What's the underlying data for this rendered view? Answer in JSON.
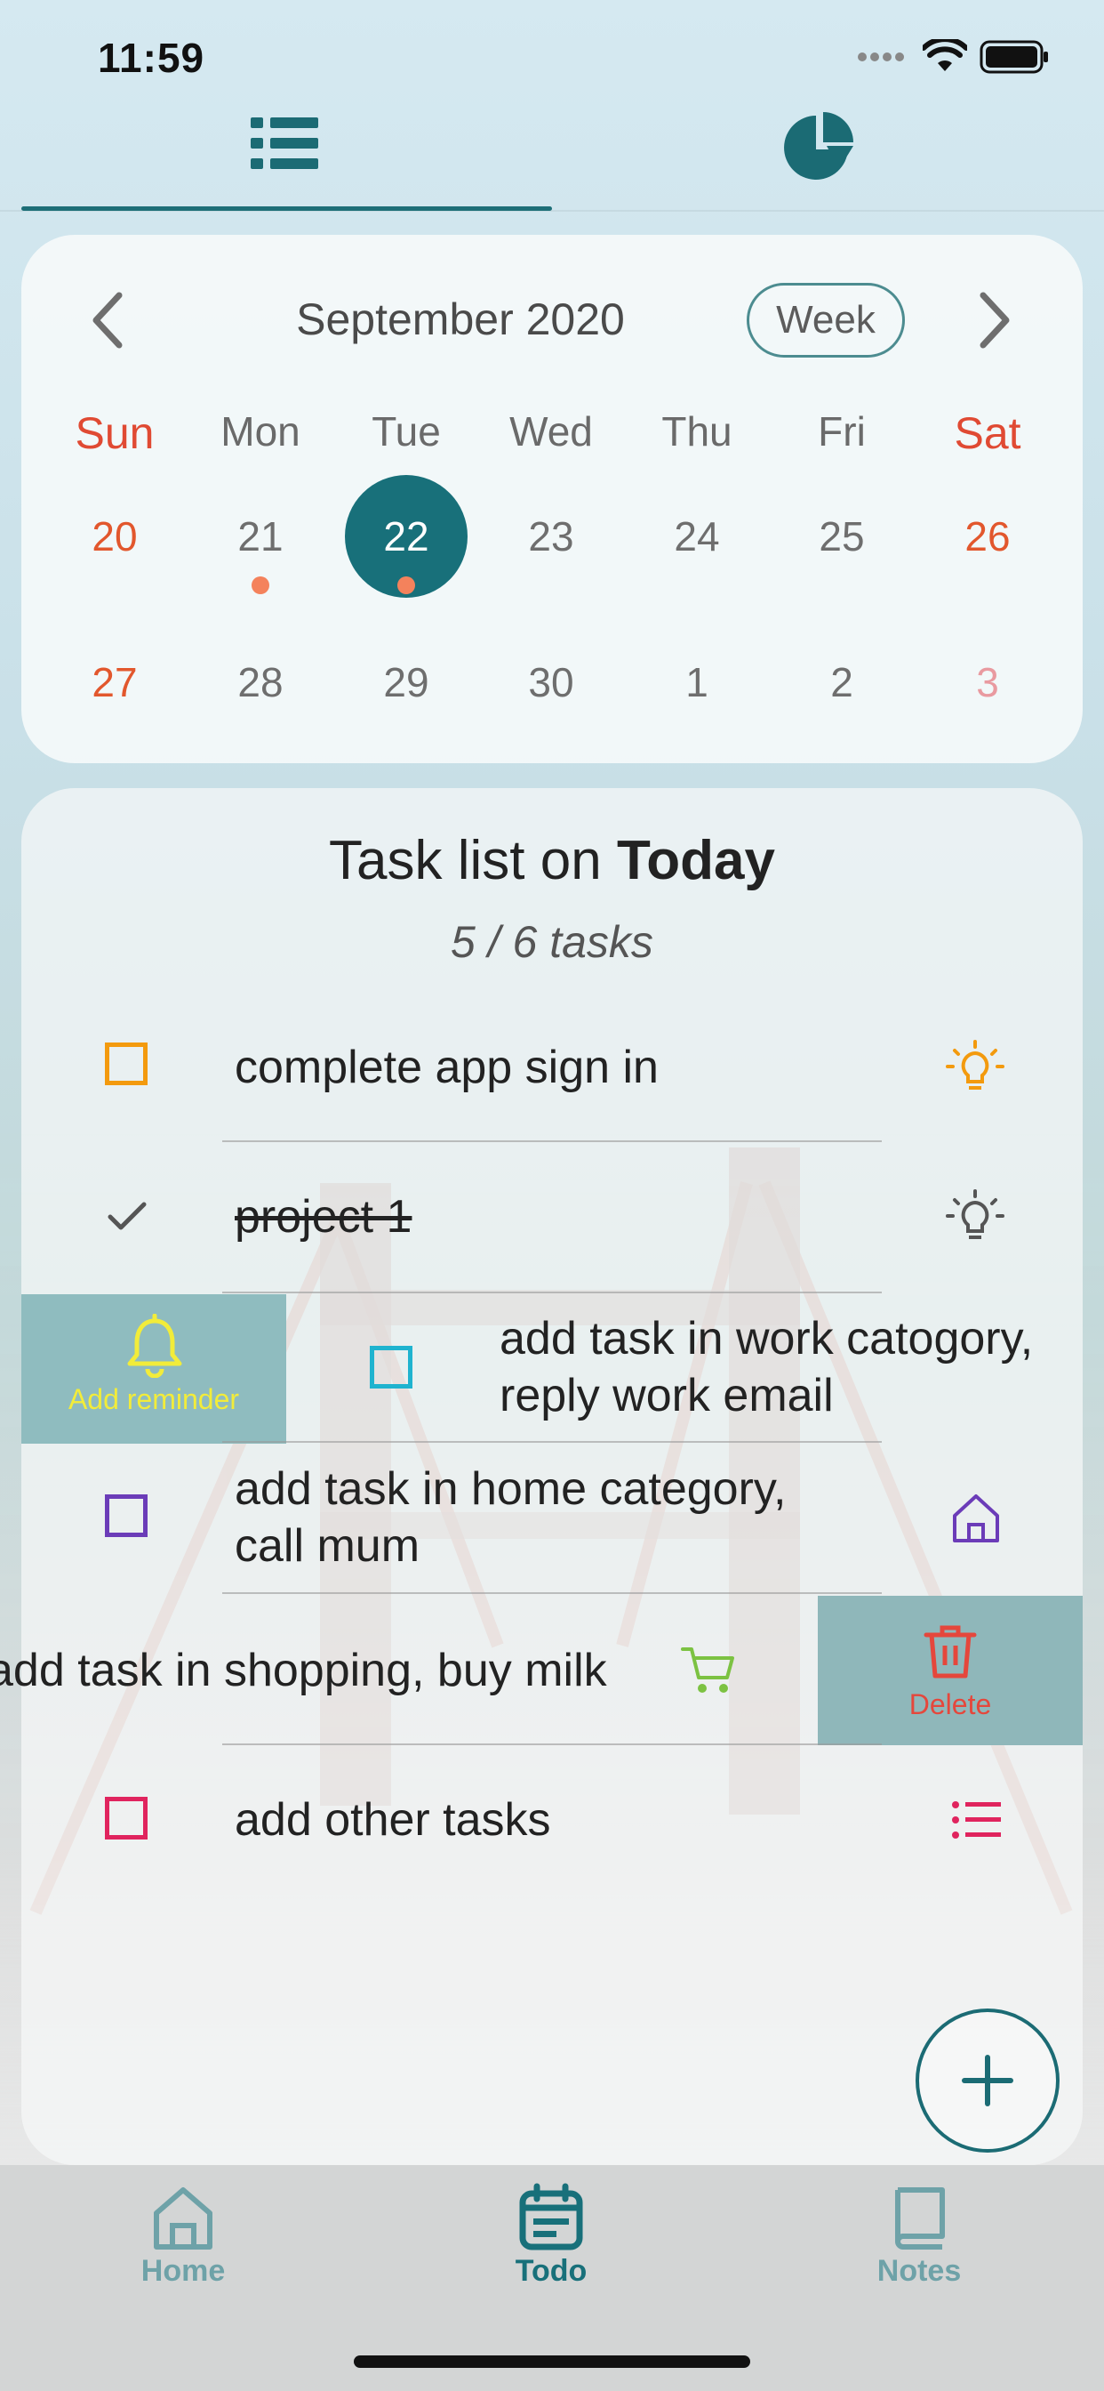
{
  "status_bar": {
    "time": "11:59"
  },
  "top_tabs": [
    {
      "name": "list",
      "icon": "list-icon",
      "active": true
    },
    {
      "name": "stats",
      "icon": "pie-chart-icon",
      "active": false
    }
  ],
  "calendar": {
    "month_label": "September 2020",
    "view_toggle": "Week",
    "weekdays": [
      "Sun",
      "Mon",
      "Tue",
      "Wed",
      "Thu",
      "Fri",
      "Sat"
    ],
    "week1": [
      "20",
      "21",
      "22",
      "23",
      "24",
      "25",
      "26"
    ],
    "week2": [
      "27",
      "28",
      "29",
      "30",
      "1",
      "2",
      "3"
    ],
    "selected": "22"
  },
  "tasks_header": {
    "prefix": "Task list on ",
    "day": "Today",
    "count": "5 / 6 tasks"
  },
  "tasks": [
    {
      "text": "complete app sign in",
      "color": "#f39a0e",
      "icon": "lightbulb-icon",
      "done": false
    },
    {
      "text": "project 1",
      "color": "#555555",
      "icon": "lightbulb-icon",
      "done": true
    },
    {
      "text": "add task in work catogory,\nreply work email",
      "color": "#1fb3cf",
      "icon": "briefcase-icon",
      "done": false
    },
    {
      "text": "add task in home category,\ncall mum",
      "color": "#6b3cb8",
      "icon": "home-icon",
      "done": false
    },
    {
      "text": "add task in shopping, buy milk",
      "color": "#7cc242",
      "icon": "cart-icon",
      "done": false
    },
    {
      "text": "add other tasks",
      "color": "#e0245e",
      "icon": "list-icon",
      "done": false
    }
  ],
  "swipe_actions": {
    "reminder": "Add reminder",
    "delete": "Delete"
  },
  "bottom_nav": [
    {
      "label": "Home",
      "icon": "home-icon",
      "active": false
    },
    {
      "label": "Todo",
      "icon": "calendar-icon",
      "active": true
    },
    {
      "label": "Notes",
      "icon": "notebook-icon",
      "active": false
    }
  ],
  "colors": {
    "accent": "#18707a",
    "weekend": "#e2572d",
    "dot": "#f4825c"
  }
}
